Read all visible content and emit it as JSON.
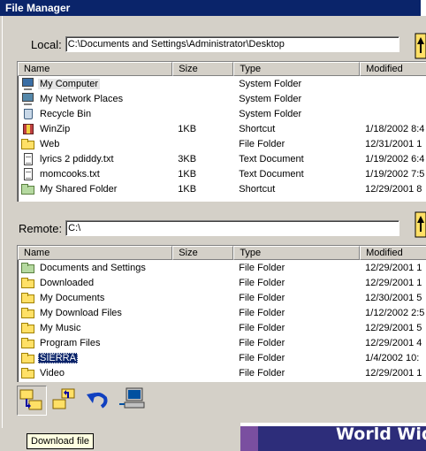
{
  "window": {
    "title": "File Manager"
  },
  "local": {
    "label": "Local:",
    "path": "C:\\Documents and Settings\\Administrator\\Desktop",
    "columns": [
      "Name",
      "Size",
      "Type",
      "Modified"
    ],
    "rows": [
      {
        "name": "My Computer",
        "size": "",
        "type": "System Folder",
        "modified": "",
        "icon": "computer-icon"
      },
      {
        "name": "My Network Places",
        "size": "",
        "type": "System Folder",
        "modified": "",
        "icon": "network-icon"
      },
      {
        "name": "Recycle Bin",
        "size": "",
        "type": "System Folder",
        "modified": "",
        "icon": "recycle-bin-icon"
      },
      {
        "name": "WinZip",
        "size": "1KB",
        "type": "Shortcut",
        "modified": "1/18/2002 8:4",
        "icon": "winzip-icon"
      },
      {
        "name": "Web",
        "size": "",
        "type": "File Folder",
        "modified": "12/31/2001 1",
        "icon": "folder-icon"
      },
      {
        "name": "lyrics 2 pdiddy.txt",
        "size": "3KB",
        "type": "Text Document",
        "modified": "1/19/2002 6:4",
        "icon": "text-file-icon"
      },
      {
        "name": "momcooks.txt",
        "size": "1KB",
        "type": "Text Document",
        "modified": "1/19/2002 7:5",
        "icon": "text-file-icon"
      },
      {
        "name": "My Shared Folder",
        "size": "1KB",
        "type": "Shortcut",
        "modified": "12/29/2001 8",
        "icon": "shared-folder-icon"
      }
    ]
  },
  "remote": {
    "label": "Remote:",
    "path": "C:\\",
    "columns": [
      "Name",
      "Size",
      "Type",
      "Modified"
    ],
    "rows": [
      {
        "name": "Documents and Settings",
        "size": "",
        "type": "File Folder",
        "modified": "12/29/2001 1",
        "icon": "shared-folder-icon"
      },
      {
        "name": "Downloaded",
        "size": "",
        "type": "File Folder",
        "modified": "12/29/2001 1",
        "icon": "folder-icon"
      },
      {
        "name": "My Documents",
        "size": "",
        "type": "File Folder",
        "modified": "12/30/2001 5",
        "icon": "folder-icon"
      },
      {
        "name": "My Download Files",
        "size": "",
        "type": "File Folder",
        "modified": "1/12/2002 2:5",
        "icon": "folder-icon"
      },
      {
        "name": "My Music",
        "size": "",
        "type": "File Folder",
        "modified": "12/29/2001 5",
        "icon": "folder-icon"
      },
      {
        "name": "Program Files",
        "size": "",
        "type": "File Folder",
        "modified": "12/29/2001 4",
        "icon": "folder-icon"
      },
      {
        "name": "SIERRA",
        "size": "",
        "type": "File Folder",
        "modified": "1/4/2002 10:",
        "icon": "folder-icon"
      },
      {
        "name": "Video",
        "size": "",
        "type": "File Folder",
        "modified": "12/29/2001 1",
        "icon": "folder-icon"
      }
    ]
  },
  "toolbar": {
    "buttons": [
      {
        "icon": "download-file-icon"
      },
      {
        "icon": "upload-file-icon"
      },
      {
        "icon": "undo-icon"
      },
      {
        "icon": "remote-computer-icon"
      }
    ]
  },
  "tooltip": "Download file",
  "banner": {
    "text": "World Wid"
  },
  "colors": {
    "titlebar": "#0a246a",
    "face": "#d4d0c8",
    "selection": "#0a246a"
  }
}
